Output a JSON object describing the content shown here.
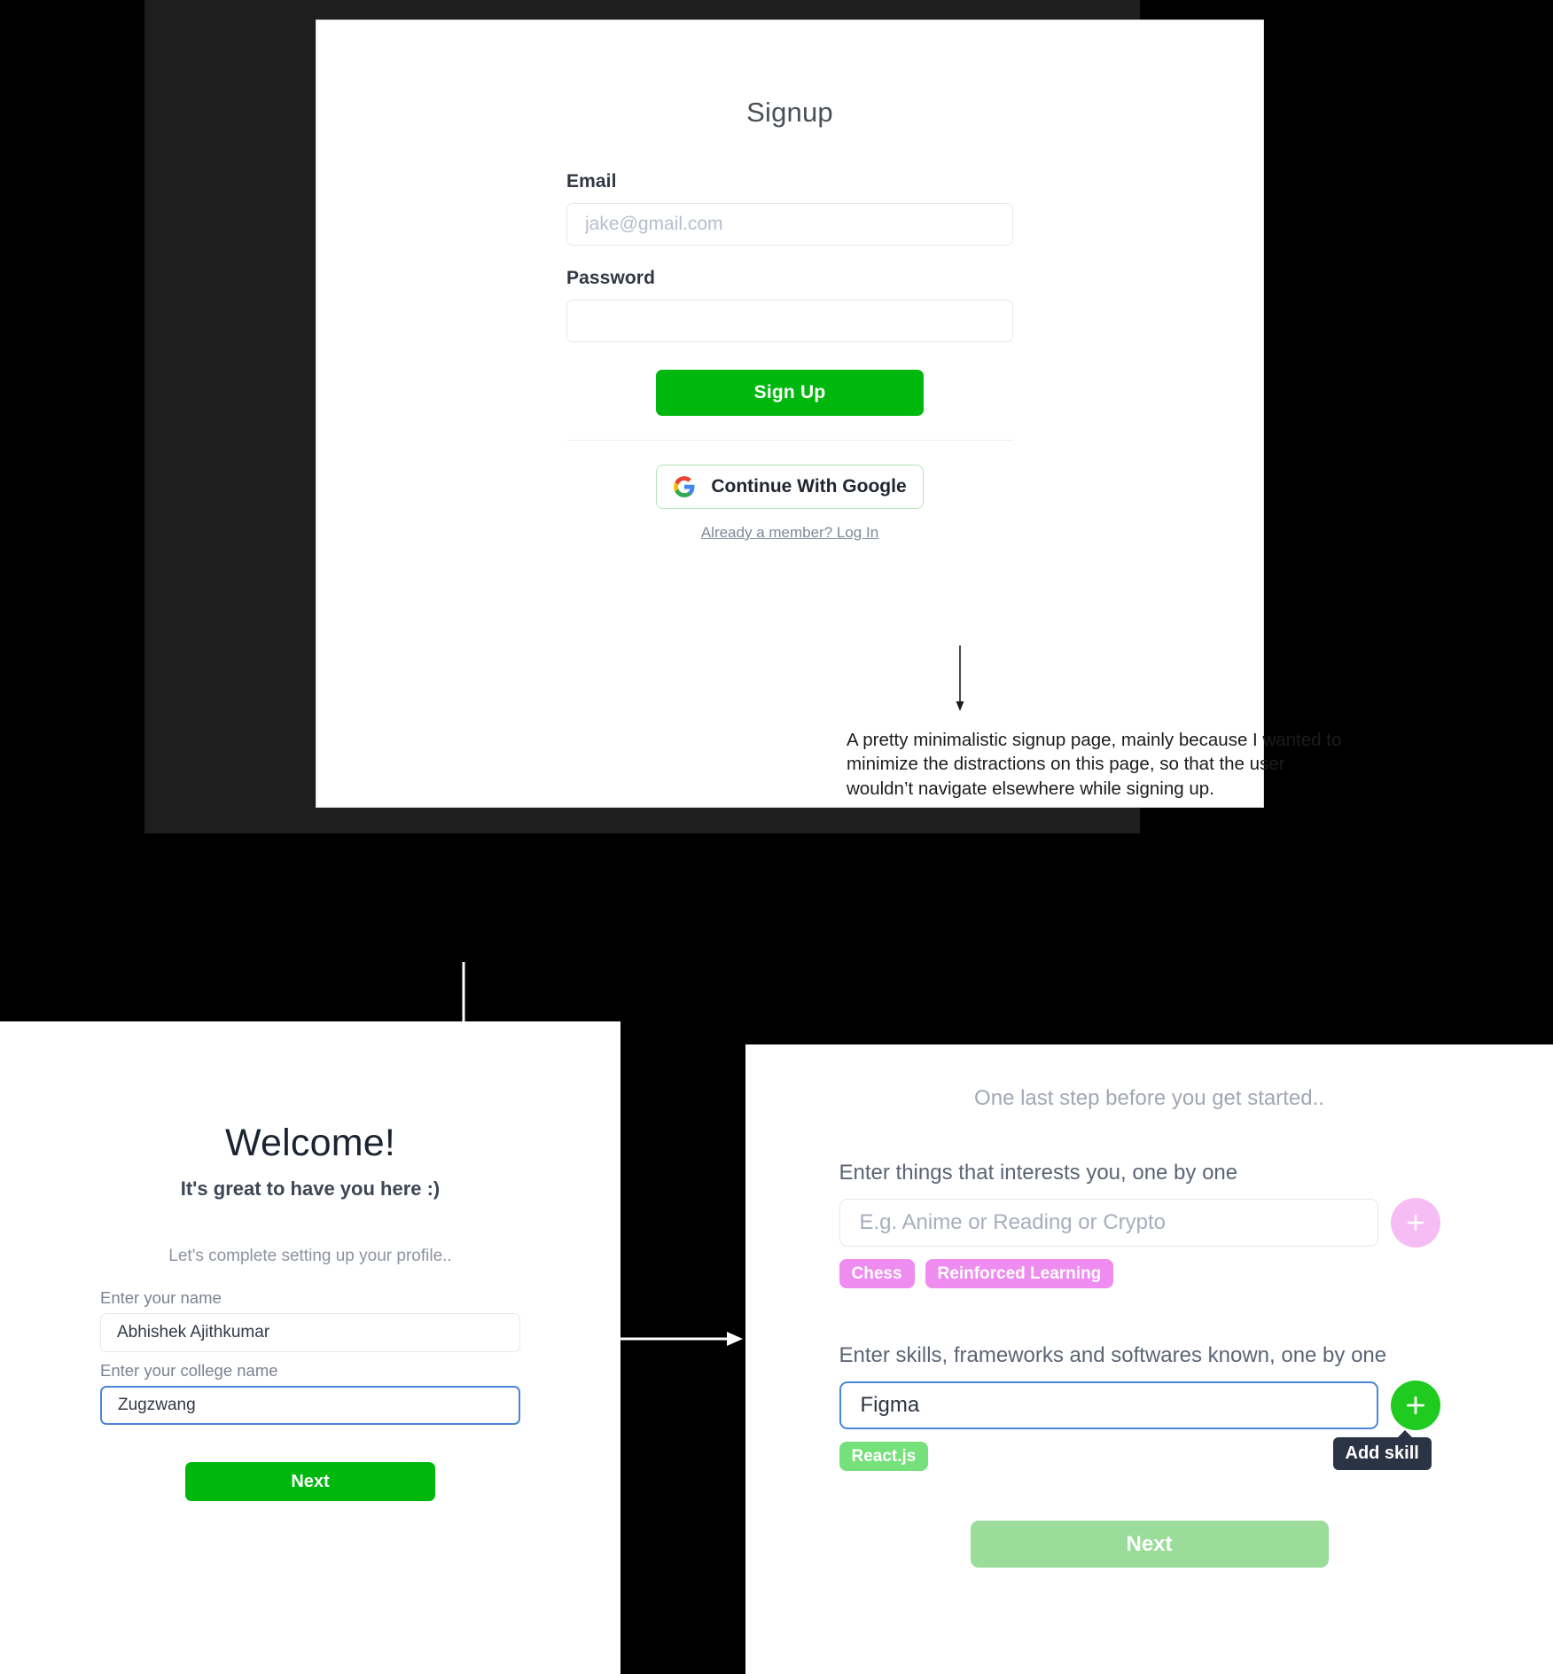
{
  "signup_screen": {
    "title": "Signup",
    "email_label": "Email",
    "email_placeholder": "jake@gmail.com",
    "email_value": "",
    "password_label": "Password",
    "password_placeholder": "",
    "password_value": "",
    "signup_button": "Sign Up",
    "google_button": "Continue With Google",
    "login_link": "Already a member? Log In",
    "annotation": "A pretty minimalistic signup page, mainly because I wanted to minimize the distractions on this page, so that the user wouldn’t navigate elsewhere while signing up."
  },
  "welcome_screen": {
    "title": "Welcome!",
    "subtitle": "It's great to have you here :)",
    "note": "Let's complete setting up your profile..",
    "name_label": "Enter your name",
    "name_value": "Abhishek Ajithkumar",
    "college_label": "Enter your college name",
    "college_value": "Zugzwang",
    "next_button": "Next"
  },
  "interests_screen": {
    "step_note": "One last step before you get started..",
    "interests_label": "Enter things that interests you, one by one",
    "interests_placeholder": "E.g. Anime or Reading or Crypto",
    "interests_value": "",
    "interests_chips": [
      "Chess",
      "Reinforced Learning"
    ],
    "skills_label": "Enter skills, frameworks and softwares known, one by one",
    "skills_placeholder": "",
    "skills_value": "Figma",
    "skills_chips": [
      "React.js"
    ],
    "add_interest_label": "+",
    "add_skill_label": "+",
    "add_skill_tooltip": "Add skill",
    "next_button": "Next"
  },
  "colors": {
    "background": "#000000",
    "device_frame": "#1e1e1e",
    "primary_green": "#00b80d",
    "disabled_green": "#9bdc9b",
    "chip_pink": "#ef8cef",
    "chip_green": "#76e07a",
    "add_pink": "#f6bdf4",
    "add_green": "#1ecb1e",
    "focus_blue": "#4b86d8",
    "tooltip_dark": "#2b3444"
  }
}
